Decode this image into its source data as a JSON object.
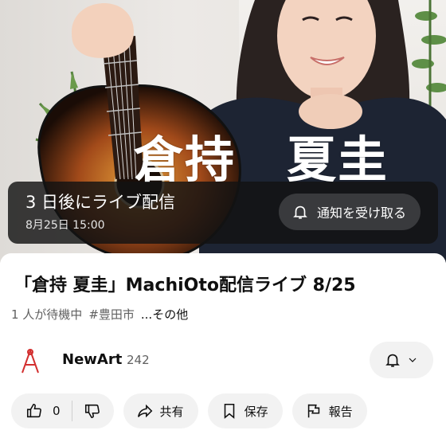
{
  "thumbnail": {
    "overlay_name": "倉持　夏圭"
  },
  "live_banner": {
    "countdown": "3 日後にライブ配信",
    "scheduled": "8月25日 15:00",
    "notify_label": "通知を受け取る"
  },
  "video": {
    "title": "「倉持 夏圭」MachiOto配信ライブ 8/25",
    "waiting": "1 人が待機中",
    "hashtag": "#豊田市",
    "more": "...その他"
  },
  "channel": {
    "name": "NewArt",
    "subscribers": "242"
  },
  "actions": {
    "like_count": "0",
    "share_label": "共有",
    "save_label": "保存",
    "report_label": "報告"
  },
  "colors": {
    "overlay_bg": "#121212",
    "pill_bg": "#f2f2f2",
    "avatar_accent": "#d32f2f"
  }
}
